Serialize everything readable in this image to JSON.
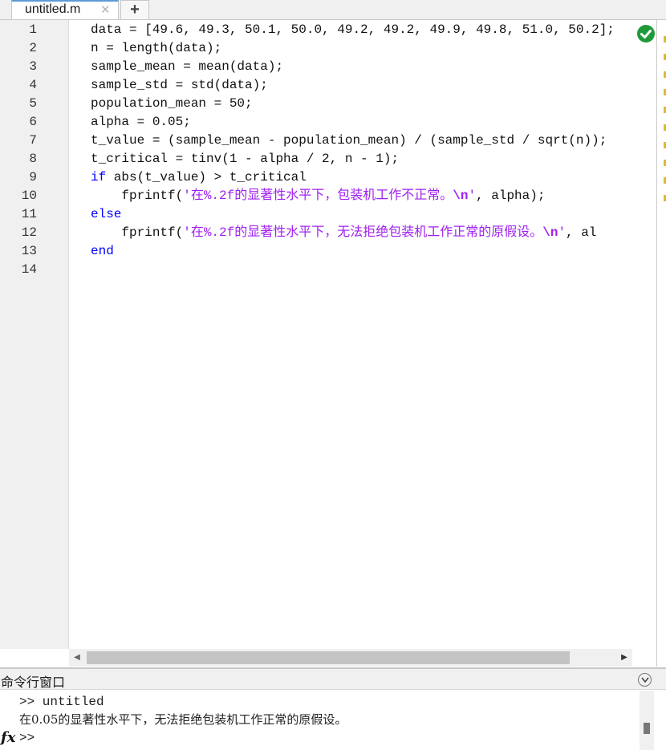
{
  "tab": {
    "label": "untitled.m",
    "close_glyph": "✕",
    "new_glyph": "+"
  },
  "editor": {
    "line_numbers": [
      "1",
      "2",
      "3",
      "4",
      "5",
      "6",
      "7",
      "8",
      "9",
      "10",
      "11",
      "12",
      "13",
      "14"
    ],
    "code": {
      "l1": "data = [49.6, 49.3, 50.1, 50.0, 49.2, 49.2, 49.9, 49.8, 51.0, 50.2];",
      "l2": "n = length(data);",
      "l3": "sample_mean = mean(data);",
      "l4": "sample_std = std(data);",
      "l5": "population_mean = 50;",
      "l6": "alpha = 0.05;",
      "l7": "t_value = (sample_mean - population_mean) / (sample_std / sqrt(n));",
      "l8": "t_critical = tinv(1 - alpha / 2, n - 1);",
      "l9_kw": "if",
      "l9_rest": " abs(t_value) > t_critical",
      "l10_pre": "    fprintf(",
      "l10_str_a": "'在%.2f的显著性水平下，包装机工作不正常。",
      "l10_esc": "\\n",
      "l10_str_b": "'",
      "l10_post": ", alpha);",
      "l11_kw": "else",
      "l12_pre": "    fprintf(",
      "l12_str_a": "'在%.2f的显著性水平下，无法拒绝包装机工作正常的原假设。",
      "l12_esc": "\\n",
      "l12_str_b": "'",
      "l12_post": ", al",
      "l13_kw": "end"
    },
    "status_icon": "check-circle-icon",
    "status_color": "#1f9a3a"
  },
  "hscroll": {
    "left_arrow": "◀",
    "right_arrow": "▶"
  },
  "command_window": {
    "title": "命令行窗口",
    "lines": [
      ">> untitled",
      "在0.05的显著性水平下，无法拒绝包装机工作正常的原假设。"
    ],
    "fx_label": "fx",
    "prompt": ">>",
    "input_value": ""
  },
  "colors": {
    "keyword": "#0000ff",
    "string": "#a020f0",
    "tab_accent": "#5b9bd5"
  }
}
